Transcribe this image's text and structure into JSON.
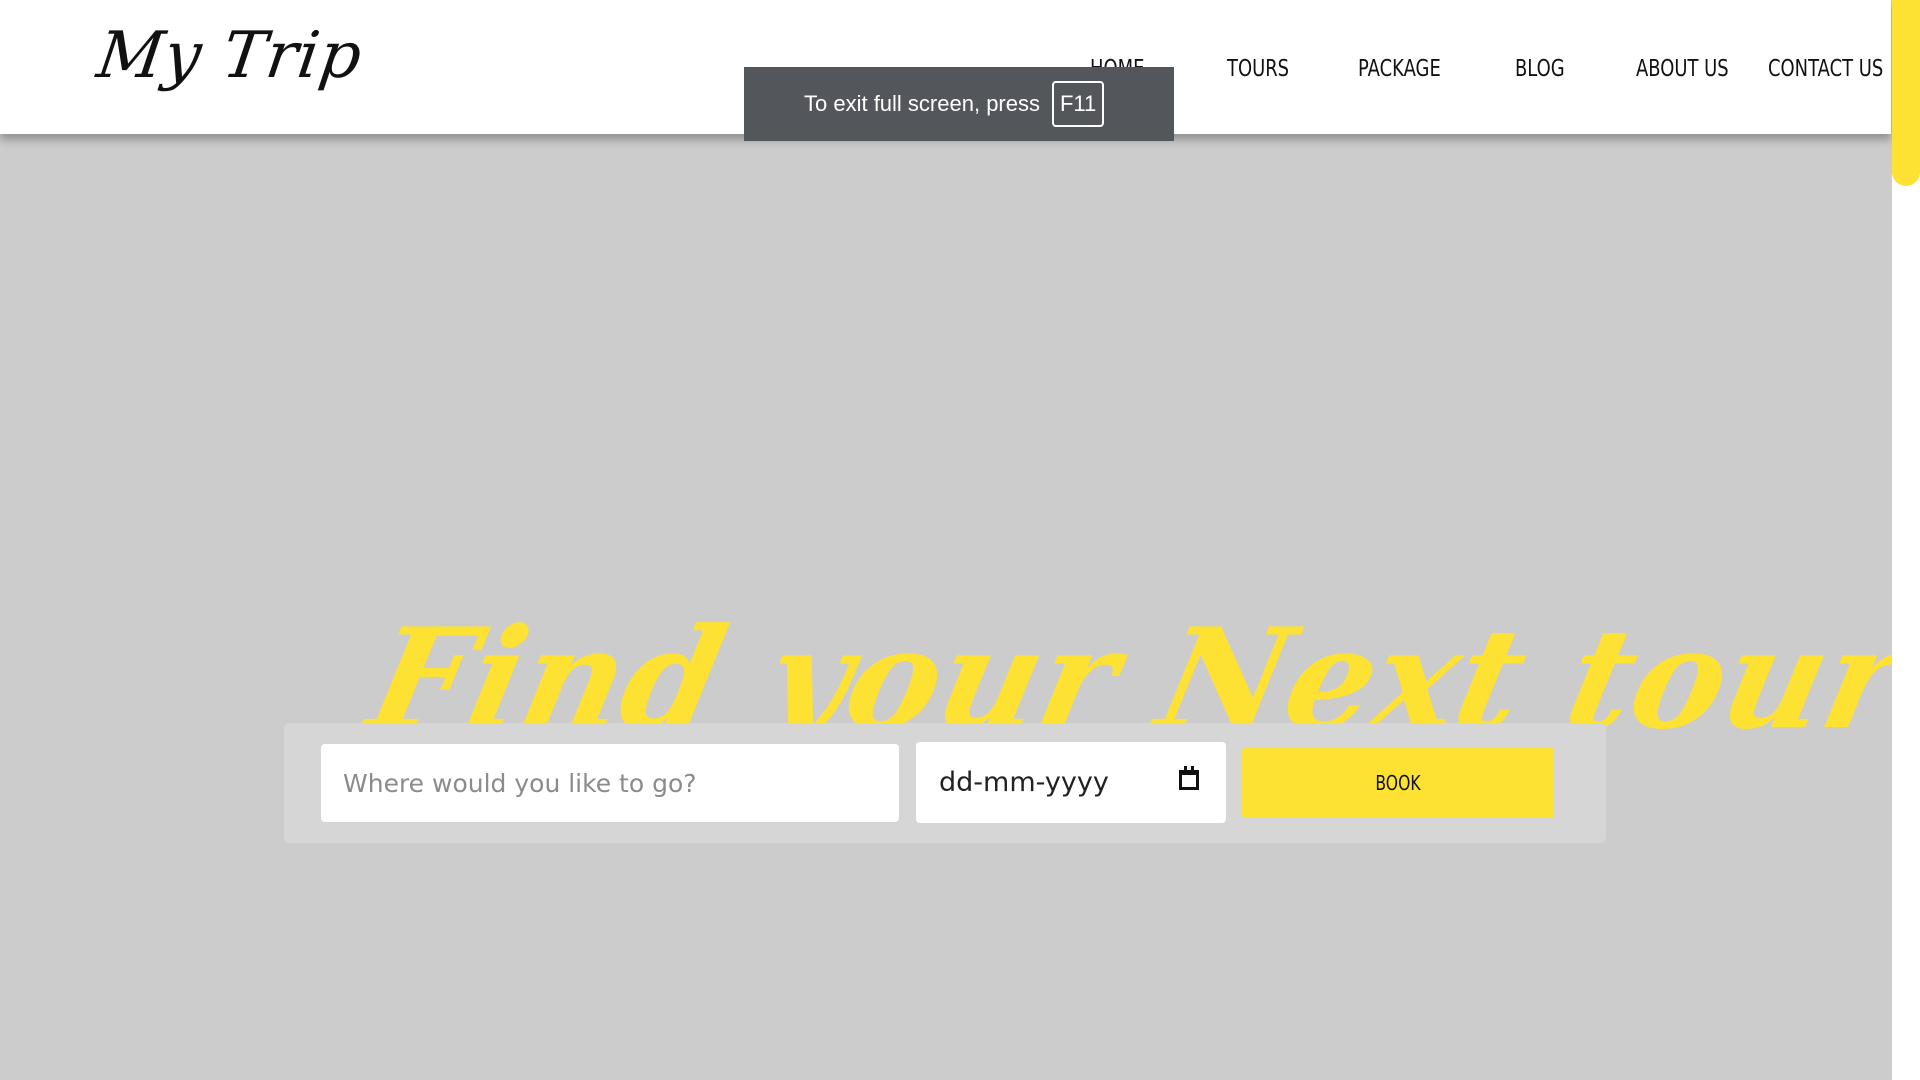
{
  "header": {
    "logo": "My Trip",
    "nav": [
      {
        "label": "HOME"
      },
      {
        "label": "TOURS"
      },
      {
        "label": "PACKAGE"
      },
      {
        "label": "BLOG"
      },
      {
        "label": "ABOUT US"
      },
      {
        "label": "CONTACT US"
      }
    ]
  },
  "browser_notice": {
    "message": "To exit full screen, press",
    "key": "F11"
  },
  "hero": {
    "title": "Find your Next tour!"
  },
  "search": {
    "destination_placeholder": "Where would you like to go?",
    "date_value": "dd-mm-yyyy",
    "book_label": "BOOK"
  },
  "icons": {
    "date_picker": "calendar-icon"
  },
  "colors": {
    "accent": "#fde233",
    "background": "#cccccc",
    "navbar": "#ffffff",
    "text": "#111111"
  }
}
